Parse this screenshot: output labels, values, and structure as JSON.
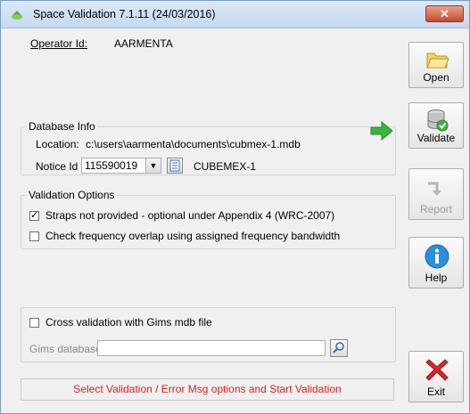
{
  "window": {
    "title": "Space Validation 7.1.11 (24/03/2016)",
    "close_label": "✕"
  },
  "operator": {
    "label": "Operator Id:",
    "value": "AARMENTA"
  },
  "database_info": {
    "legend": "Database Info",
    "location_label": "Location:",
    "location_value": "c:\\users\\aarmenta\\documents\\cubmex-1.mdb",
    "notice_label": "Notice Id",
    "notice_value": "115590019",
    "notice_name": "CUBEMEX-1"
  },
  "validation_options": {
    "legend": "Validation Options",
    "options": [
      {
        "label": "Straps not provided - optional under Appendix 4 (WRC-2007)",
        "checked": true
      },
      {
        "label": "Check frequency overlap using assigned frequency bandwidth",
        "checked": false
      }
    ]
  },
  "cross_validation": {
    "label": "Cross validation with Gims mdb file",
    "checked": false,
    "gims_label": "Gims database:",
    "gims_value": ""
  },
  "status_message": "Select Validation / Error Msg options and Start Validation",
  "buttons": {
    "open": "Open",
    "validate": "Validate",
    "report": "Report",
    "help": "Help",
    "exit": "Exit"
  },
  "colors": {
    "status_text": "#e02020",
    "arrow_green": "#3cb33c",
    "exit_red": "#d8262b",
    "help_blue": "#2b8fdd"
  }
}
